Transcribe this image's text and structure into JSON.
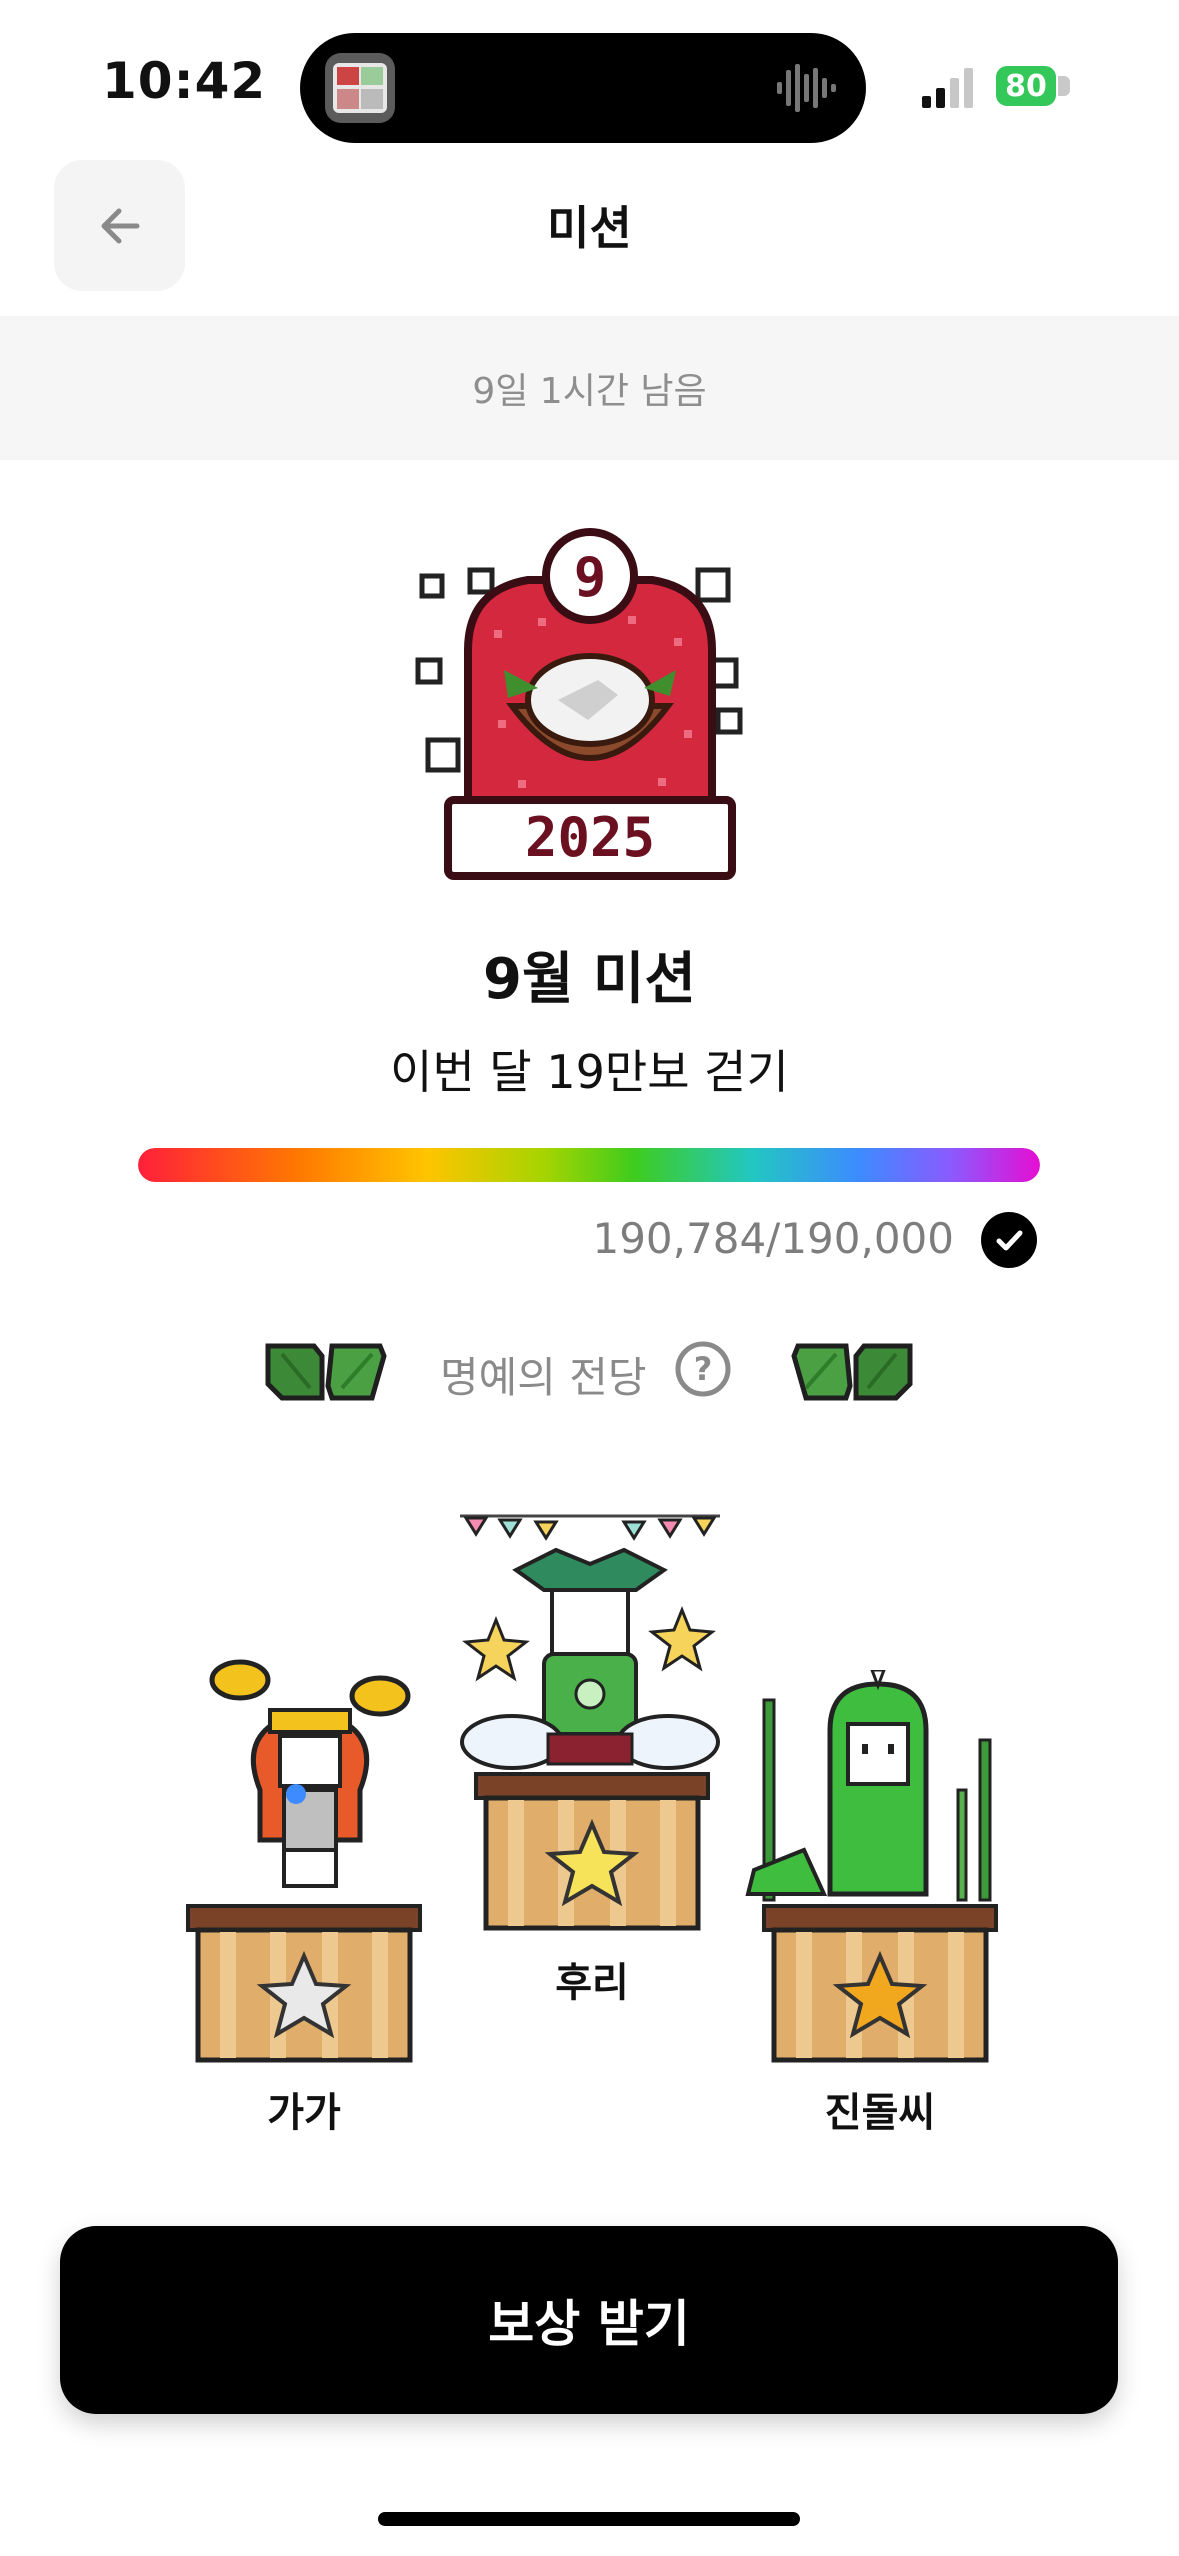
{
  "status_bar": {
    "time": "10:42",
    "battery": "80"
  },
  "header": {
    "title": "미션",
    "back_icon": "arrow-left-icon"
  },
  "countdown": "9일 1시간 남음",
  "mission": {
    "badge_number": "9",
    "badge_year": "2025",
    "title": "9월 미션",
    "description": "이번 달 19만보 걷기",
    "progress_text": "190,784/190,000",
    "progress_fraction": 1.0,
    "completed": true
  },
  "hall_of_fame": {
    "label": "명예의 전당",
    "help_icon": "question-circle-icon",
    "ranks": [
      {
        "place": 2,
        "name": "가가"
      },
      {
        "place": 1,
        "name": "후리"
      },
      {
        "place": 3,
        "name": "진돌씨"
      }
    ]
  },
  "cta": {
    "label": "보상 받기"
  },
  "colors": {
    "accent_black": "#000000",
    "battery_green": "#34c759",
    "badge_red": "#d4283f",
    "muted_gray": "#8e8e8e"
  }
}
